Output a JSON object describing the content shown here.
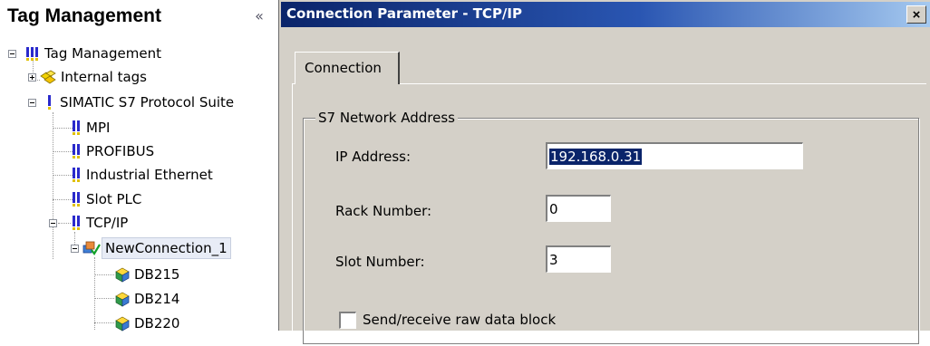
{
  "tree_panel": {
    "title": "Tag Management",
    "collapse_glyph": "«",
    "nodes": [
      {
        "label": "Tag Management",
        "icon": "tag-management-icon"
      },
      {
        "label": "Internal tags",
        "icon": "internal-tags-icon"
      },
      {
        "label": "SIMATIC S7 Protocol Suite",
        "icon": "protocol-suite-icon"
      },
      {
        "label": "MPI",
        "icon": "channel-unit-icon"
      },
      {
        "label": "PROFIBUS",
        "icon": "channel-unit-icon"
      },
      {
        "label": "Industrial Ethernet",
        "icon": "channel-unit-icon"
      },
      {
        "label": "Slot PLC",
        "icon": "channel-unit-icon"
      },
      {
        "label": "TCP/IP",
        "icon": "channel-unit-icon"
      },
      {
        "label": "NewConnection_1",
        "icon": "connection-icon",
        "selected": true
      },
      {
        "label": "DB215",
        "icon": "tag-group-icon"
      },
      {
        "label": "DB214",
        "icon": "tag-group-icon"
      },
      {
        "label": "DB220",
        "icon": "tag-group-icon"
      }
    ]
  },
  "dialog": {
    "title": "Connection Parameter - TCP/IP",
    "close_glyph": "×",
    "tabs": [
      {
        "label": "Connection",
        "active": true
      }
    ],
    "group_title": "S7 Network Address",
    "fields": {
      "ip_address": {
        "label": "IP Address:",
        "value": "192.168.0.31"
      },
      "rack_number": {
        "label": "Rack Number:",
        "value": "0"
      },
      "slot_number": {
        "label": "Slot Number:",
        "value": "3"
      }
    },
    "raw_data_checkbox": {
      "label": "Send/receive raw data block",
      "checked": false
    }
  },
  "colors": {
    "title_bar_start": "#0a246a",
    "title_bar_end": "#a6caf0",
    "dialog_face": "#d4d0c8",
    "selection": "#0a246a"
  }
}
